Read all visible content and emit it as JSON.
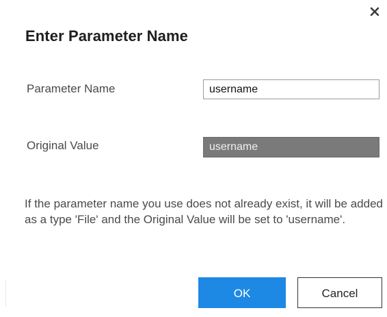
{
  "dialog": {
    "title": "Enter Parameter Name",
    "close_icon": "close-icon"
  },
  "form": {
    "parameter_name_label": "Parameter Name",
    "parameter_name_value": "username",
    "original_value_label": "Original Value",
    "original_value": "username"
  },
  "message": "If the parameter name you use does not already exist, it will be added as a type 'File' and the Original Value will be set to 'username'.",
  "buttons": {
    "ok_label": "OK",
    "cancel_label": "Cancel"
  },
  "colors": {
    "ok_button": "#1e88e5",
    "original_value_bg": "#7a7a7a"
  }
}
